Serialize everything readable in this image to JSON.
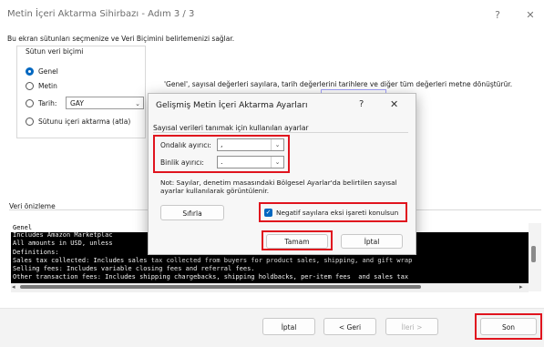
{
  "window": {
    "title": "Metin İçeri Aktarma Sihirbazı - Adım 3 / 3",
    "help_glyph": "?",
    "close_glyph": "✕"
  },
  "intro_text": "Bu ekran sütunları seçmenize ve Veri Biçimini belirlemenizi sağlar.",
  "column_format": {
    "legend": "Sütun veri biçimi",
    "options": [
      "Genel",
      "Metin",
      "Tarih:",
      "Sütunu içeri aktarma (atla)"
    ],
    "selected": "Genel",
    "date_format": "GAY",
    "info": "'Genel', sayısal değerleri sayılara, tarih değerlerini tarihlere ve diğer tüm değerleri metne dönüştürür."
  },
  "preview": {
    "legend": "Veri önizleme",
    "lines": [
      "Genel",
      "Includes Amazon Marketplac                                                       nsactions",
      "All amounts in USD, unless",
      "Definitions:",
      "Sales tax collected: Includes sales tax collected from buyers for product sales, shipping, and gift wrap",
      "Selling fees: Includes variable closing fees and referral fees.",
      "Other transaction fees: Includes shipping chargebacks, shipping holdbacks, per-item fees  and sales tax"
    ]
  },
  "footer": {
    "cancel": "İptal",
    "back": "< Geri",
    "next": "İleri >",
    "finish": "Son"
  },
  "dialog": {
    "title": "Gelişmiş Metin İçeri Aktarma Ayarları",
    "help_glyph": "?",
    "close_glyph": "✕",
    "caption": "Sayısal verileri tanımak için kullanılan ayarlar",
    "decimal_label": "Ondalık ayırıcı:",
    "decimal_value": ",",
    "thousands_label": "Binlik ayırıcı:",
    "thousands_value": ".",
    "note": "Not: Sayılar, denetim masasındaki Bölgesel Ayarlar'da belirtilen sayısal ayarlar kullanılarak görüntülenir.",
    "reset": "Sıfırla",
    "negative_label": "Negatif sayılara eksi işareti konulsun",
    "negative_checked": true,
    "ok": "Tamam",
    "cancel": "İptal"
  },
  "colors": {
    "accent": "#0067c0",
    "highlight": "#e0141e"
  }
}
